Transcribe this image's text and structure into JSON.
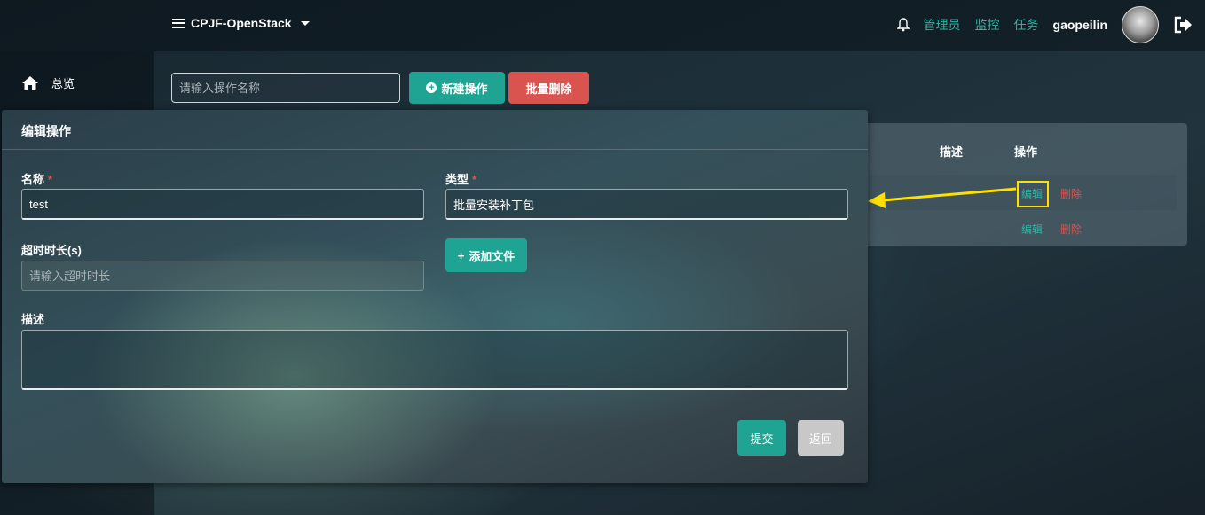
{
  "topbar": {
    "project": "CPJF-OpenStack",
    "links": [
      "管理员",
      "监控",
      "任务"
    ],
    "username": "gaopeilin"
  },
  "sidebar": {
    "items": [
      {
        "label": "总览",
        "icon": "home-icon"
      }
    ]
  },
  "toolbar": {
    "search_placeholder": "请输入操作名称",
    "new_label": "新建操作",
    "batch_delete_label": "批量删除"
  },
  "table": {
    "headers": {
      "description": "描述",
      "action": "操作"
    },
    "rows": [
      {
        "edit": "编辑",
        "delete": "删除"
      },
      {
        "edit": "编辑",
        "delete": "删除"
      }
    ]
  },
  "modal": {
    "title": "编辑操作",
    "name_label": "名称",
    "name_value": "test",
    "type_label": "类型",
    "type_value": "批量安装补丁包",
    "timeout_label": "超时时长(s)",
    "timeout_placeholder": "请输入超时时长",
    "add_file_label": "添加文件",
    "desc_label": "描述",
    "submit_label": "提交",
    "back_label": "返回"
  },
  "colors": {
    "accent": "#1fa493",
    "danger": "#d9534f",
    "highlight": "#ffe100"
  }
}
